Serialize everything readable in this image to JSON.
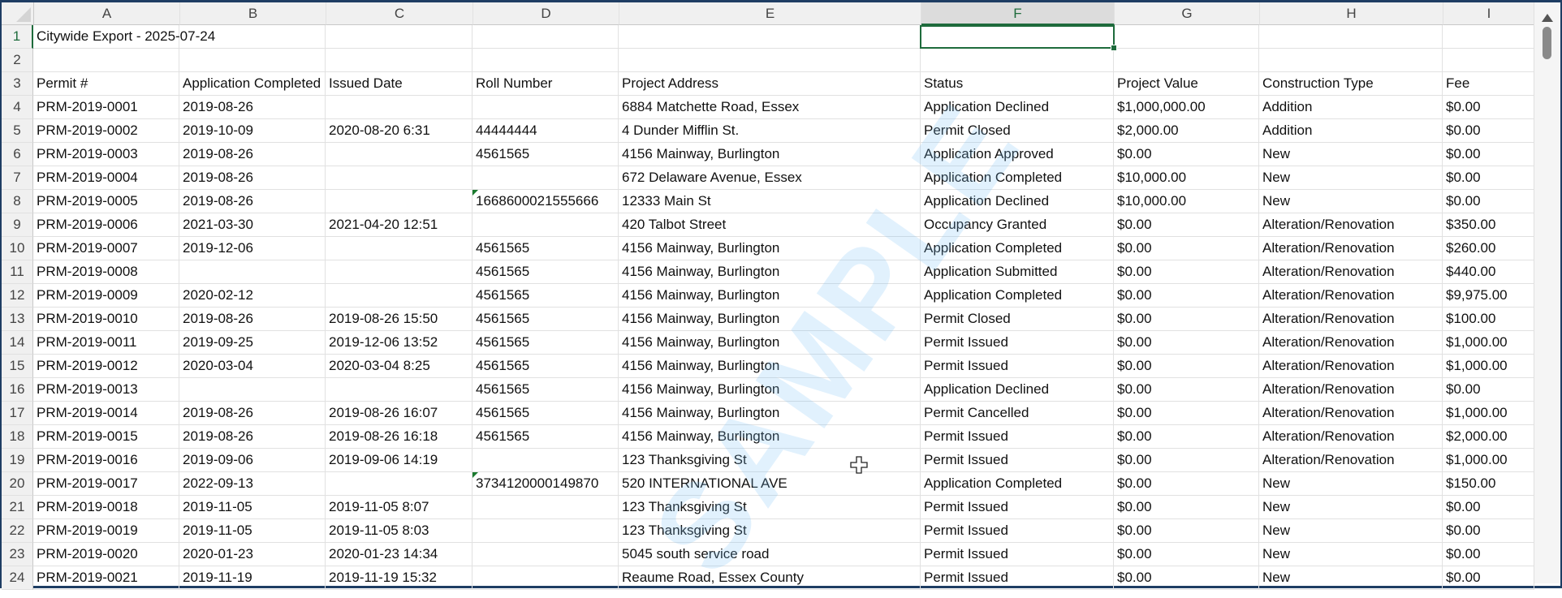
{
  "columns": [
    "A",
    "B",
    "C",
    "D",
    "E",
    "F",
    "G",
    "H",
    "I"
  ],
  "selected_cell": "F1",
  "title_cell": "Citywide Export - 2025-07-24",
  "headers": [
    "Permit #",
    "Application Completed Date",
    "Issued Date",
    "Roll Number",
    "Project Address",
    "Status",
    "Project Value",
    "Construction Type",
    "Fee"
  ],
  "watermark": "SAMPLE",
  "rows": [
    [
      "PRM-2019-0001",
      "2019-08-26",
      "",
      "",
      "6884 Matchette Road, Essex",
      "Application Declined",
      "$1,000,000.00",
      "Addition",
      "$0.00"
    ],
    [
      "PRM-2019-0002",
      "2019-10-09",
      "2020-08-20 6:31",
      "44444444",
      "4 Dunder Mifflin St.",
      "Permit Closed",
      "$2,000.00",
      "Addition",
      "$0.00"
    ],
    [
      "PRM-2019-0003",
      "2019-08-26",
      "",
      "4561565",
      "4156 Mainway, Burlington",
      "Application Approved",
      "$0.00",
      "New",
      "$0.00"
    ],
    [
      "PRM-2019-0004",
      "2019-08-26",
      "",
      "",
      "672 Delaware Avenue, Essex",
      "Application Completed",
      "$10,000.00",
      "New",
      "$0.00"
    ],
    [
      "PRM-2019-0005",
      "2019-08-26",
      "",
      "1668600021555666",
      "12333 Main St",
      "Application Declined",
      "$10,000.00",
      "New",
      "$0.00"
    ],
    [
      "PRM-2019-0006",
      "2021-03-30",
      "2021-04-20 12:51",
      "",
      "420 Talbot Street",
      "Occupancy Granted",
      "$0.00",
      "Alteration/Renovation",
      "$350.00"
    ],
    [
      "PRM-2019-0007",
      "2019-12-06",
      "",
      "4561565",
      "4156 Mainway, Burlington",
      "Application Completed",
      "$0.00",
      "Alteration/Renovation",
      "$260.00"
    ],
    [
      "PRM-2019-0008",
      "",
      "",
      "4561565",
      "4156 Mainway, Burlington",
      "Application Submitted",
      "$0.00",
      "Alteration/Renovation",
      "$440.00"
    ],
    [
      "PRM-2019-0009",
      "2020-02-12",
      "",
      "4561565",
      "4156 Mainway, Burlington",
      "Application Completed",
      "$0.00",
      "Alteration/Renovation",
      "$9,975.00"
    ],
    [
      "PRM-2019-0010",
      "2019-08-26",
      "2019-08-26 15:50",
      "4561565",
      "4156 Mainway, Burlington",
      "Permit Closed",
      "$0.00",
      "Alteration/Renovation",
      "$100.00"
    ],
    [
      "PRM-2019-0011",
      "2019-09-25",
      "2019-12-06 13:52",
      "4561565",
      "4156 Mainway, Burlington",
      "Permit Issued",
      "$0.00",
      "Alteration/Renovation",
      "$1,000.00"
    ],
    [
      "PRM-2019-0012",
      "2020-03-04",
      "2020-03-04 8:25",
      "4561565",
      "4156 Mainway, Burlington",
      "Permit Issued",
      "$0.00",
      "Alteration/Renovation",
      "$1,000.00"
    ],
    [
      "PRM-2019-0013",
      "",
      "",
      "4561565",
      "4156 Mainway, Burlington",
      "Application Declined",
      "$0.00",
      "Alteration/Renovation",
      "$0.00"
    ],
    [
      "PRM-2019-0014",
      "2019-08-26",
      "2019-08-26 16:07",
      "4561565",
      "4156 Mainway, Burlington",
      "Permit Cancelled",
      "$0.00",
      "Alteration/Renovation",
      "$1,000.00"
    ],
    [
      "PRM-2019-0015",
      "2019-08-26",
      "2019-08-26 16:18",
      "4561565",
      "4156 Mainway, Burlington",
      "Permit Issued",
      "$0.00",
      "Alteration/Renovation",
      "$2,000.00"
    ],
    [
      "PRM-2019-0016",
      "2019-09-06",
      "2019-09-06 14:19",
      "",
      "123 Thanksgiving St",
      "Permit Issued",
      "$0.00",
      "Alteration/Renovation",
      "$1,000.00"
    ],
    [
      "PRM-2019-0017",
      "2022-09-13",
      "",
      "3734120000149870",
      "520 INTERNATIONAL AVE",
      "Application Completed",
      "$0.00",
      "New",
      "$150.00"
    ],
    [
      "PRM-2019-0018",
      "2019-11-05",
      "2019-11-05 8:07",
      "",
      "123 Thanksgiving St",
      "Permit Issued",
      "$0.00",
      "New",
      "$0.00"
    ],
    [
      "PRM-2019-0019",
      "2019-11-05",
      "2019-11-05 8:03",
      "",
      "123 Thanksgiving St",
      "Permit Issued",
      "$0.00",
      "New",
      "$0.00"
    ],
    [
      "PRM-2019-0020",
      "2020-01-23",
      "2020-01-23 14:34",
      "",
      "5045 south service road",
      "Permit Issued",
      "$0.00",
      "New",
      "$0.00"
    ],
    [
      "PRM-2019-0021",
      "2019-11-19",
      "2019-11-19 15:32",
      "",
      "Reaume Road, Essex County",
      "Permit Issued",
      "$0.00",
      "New",
      "$0.00"
    ]
  ],
  "text_number_flags": [
    "D8",
    "D20"
  ]
}
